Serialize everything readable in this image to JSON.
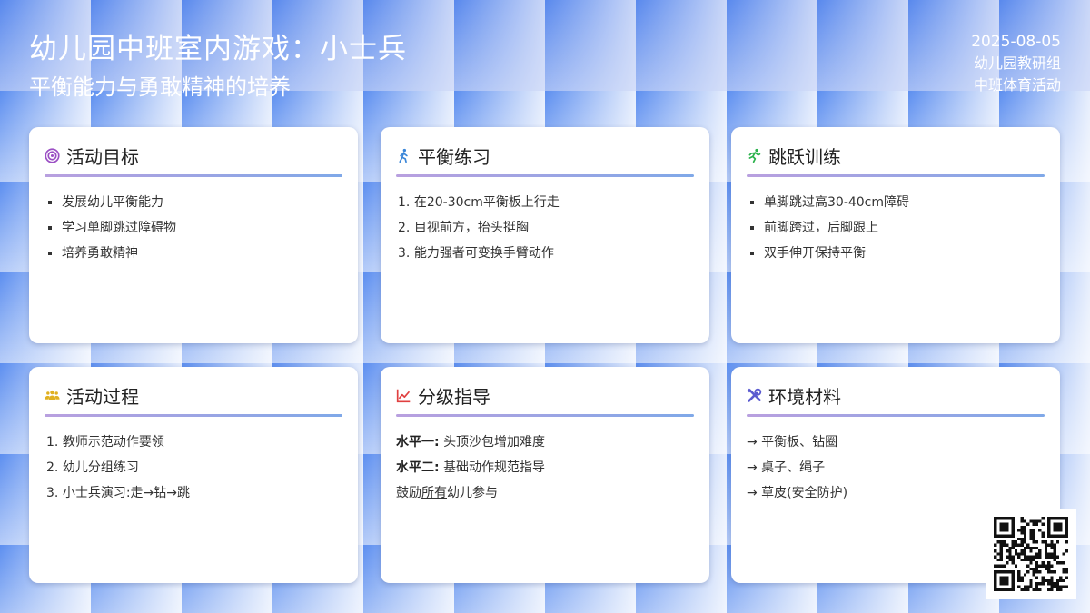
{
  "header": {
    "title": "幼儿园中班室内游戏：小士兵",
    "subtitle": "平衡能力与勇敢精神的培养",
    "date": "2025-08-05",
    "org": "幼儿园教研组",
    "activity_type": "中班体育活动"
  },
  "cards": {
    "goals": {
      "title": "活动目标",
      "icon": "target-icon",
      "items": [
        "发展幼儿平衡能力",
        "学习单脚跳过障碍物",
        "培养勇敢精神"
      ]
    },
    "balance": {
      "title": "平衡练习",
      "icon": "walking-person-icon",
      "items": [
        "在20-30cm平衡板上行走",
        "目视前方，抬头挺胸",
        "能力强者可变换手臂动作"
      ]
    },
    "jump": {
      "title": "跳跃训练",
      "icon": "running-person-icon",
      "items": [
        "单脚跳过高30-40cm障碍",
        "前脚跨过，后脚跟上",
        "双手伸开保持平衡"
      ]
    },
    "process": {
      "title": "活动过程",
      "icon": "people-group-icon",
      "items": [
        "教师示范动作要领",
        "幼儿分组练习",
        "小士兵演习:走→钻→跳"
      ]
    },
    "levels": {
      "title": "分级指导",
      "icon": "line-chart-icon",
      "level1_label": "水平一:",
      "level1_text": "头顶沙包增加难度",
      "level2_label": "水平二:",
      "level2_text": "基础动作规范指导",
      "encourage_pre": "鼓励",
      "encourage_em": "所有",
      "encourage_post": "幼儿参与"
    },
    "materials": {
      "title": "环境材料",
      "icon": "tools-icon",
      "items": [
        "→ 平衡板、钻圈",
        "→ 桌子、绳子",
        "→ 草皮(安全防护)"
      ]
    }
  },
  "qr": {
    "icon": "qr-code-icon"
  },
  "colors": {
    "background": "#5d8ff0",
    "divider_start": "#b9a0df",
    "divider_end": "#7fa8e8",
    "target_icon": "#9b4fc4",
    "walk_icon": "#3a86d8",
    "run_icon": "#2bb24c",
    "group_icon": "#e0b020",
    "chart_icon": "#e04040",
    "tools_icon": "#5a5ad0"
  }
}
